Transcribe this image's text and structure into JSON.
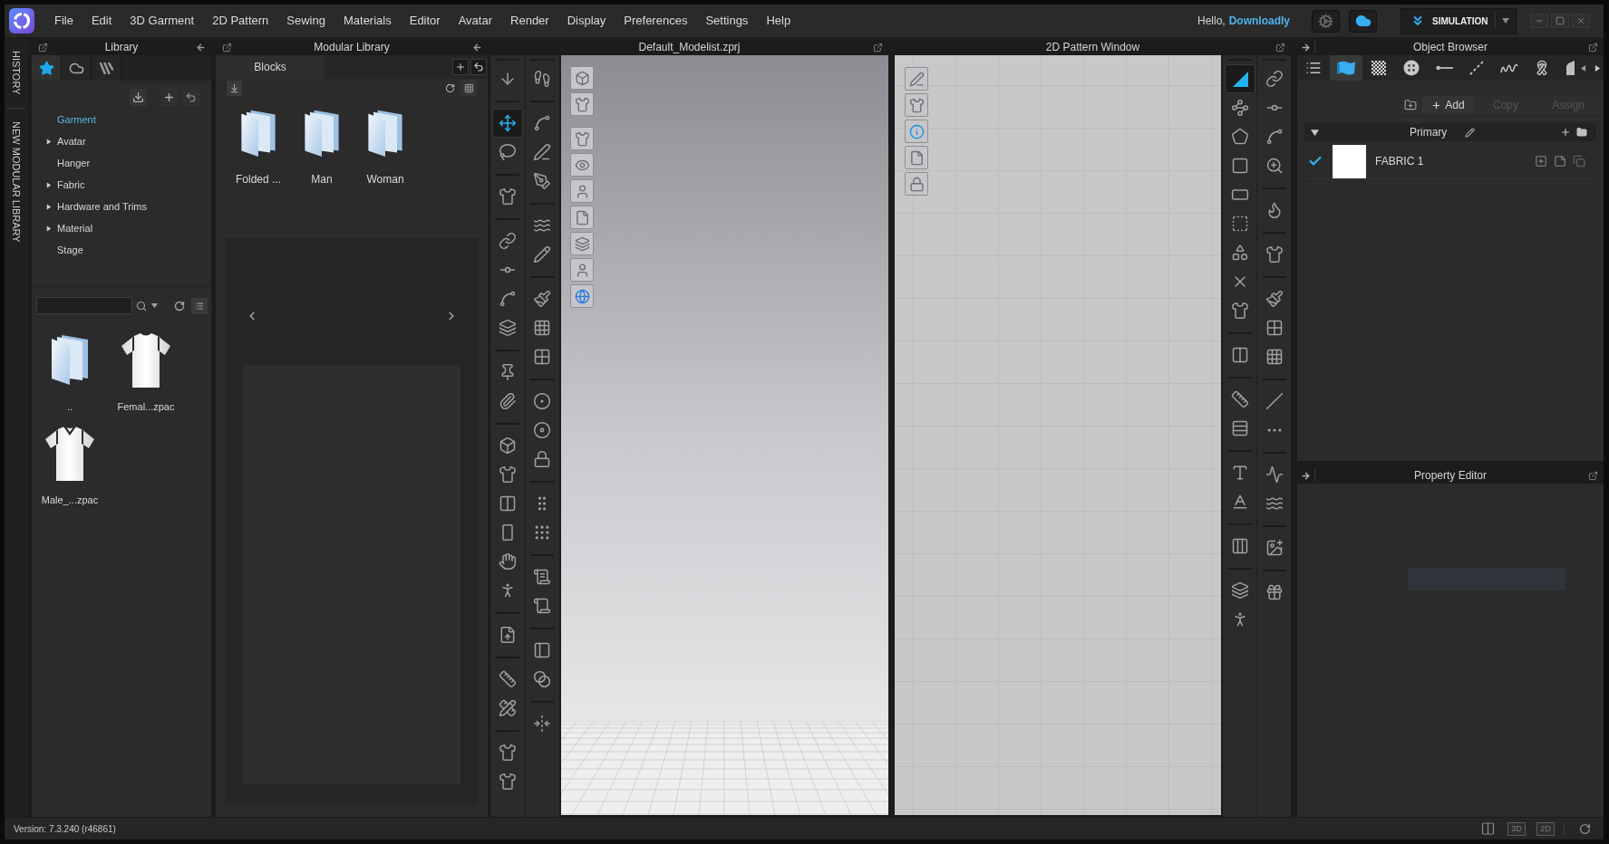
{
  "menu_bar": {
    "items": [
      "File",
      "Edit",
      "3D Garment",
      "2D Pattern",
      "Sewing",
      "Materials",
      "Editor",
      "Avatar",
      "Render",
      "Display",
      "Preferences",
      "Settings",
      "Help"
    ],
    "greeting": "Hello,",
    "user": "Downloadly",
    "mode": "SIMULATION"
  },
  "side_tabs": [
    {
      "label": "HISTORY"
    },
    {
      "label": "NEW MODULAR LIBRARY"
    }
  ],
  "library": {
    "title": "Library",
    "tabs": [
      {
        "selected": true
      },
      {
        "selected": false
      },
      {
        "selected": false
      }
    ],
    "tree": [
      {
        "label": "Garment",
        "selected": true,
        "expandable": false
      },
      {
        "label": "Avatar",
        "selected": false,
        "expandable": true
      },
      {
        "label": "Hanger",
        "selected": false,
        "expandable": false
      },
      {
        "label": "Fabric",
        "selected": false,
        "expandable": true
      },
      {
        "label": "Hardware and Trims",
        "selected": false,
        "expandable": true
      },
      {
        "label": "Material",
        "selected": false,
        "expandable": true
      },
      {
        "label": "Stage",
        "selected": false,
        "expandable": false
      }
    ],
    "files": [
      {
        "name": "..",
        "kind": "folder"
      },
      {
        "name": "Femal...zpac",
        "kind": "tshirt"
      },
      {
        "name": "Male_...zpac",
        "kind": "vneck"
      }
    ]
  },
  "modular_library": {
    "title": "Modular Library",
    "tabs": [
      {
        "label": "Blocks",
        "selected": true
      }
    ],
    "folders": [
      {
        "name": "Folded ..."
      },
      {
        "name": "Man"
      },
      {
        "name": "Woman"
      }
    ]
  },
  "window_3d": {
    "title": "Default_Modelist.zprj",
    "toolbar": [
      {
        "groups": [
          [
            {
              "selected": false
            }
          ],
          [
            {
              "selected": true
            },
            {
              "selected": false
            }
          ],
          [
            {
              "selected": false
            }
          ],
          [
            {
              "selected": false
            },
            {
              "selected": false
            },
            {
              "selected": false
            },
            {
              "selected": false
            }
          ],
          [
            {
              "selected": false
            },
            {
              "selected": false
            }
          ],
          [
            {
              "selected": false
            },
            {
              "selected": false
            },
            {
              "selected": false
            },
            {
              "selected": false
            },
            {
              "selected": false
            },
            {
              "selected": false
            }
          ],
          [
            {
              "selected": false
            }
          ],
          [
            {
              "selected": false
            },
            {
              "selected": false
            }
          ],
          [
            {
              "selected": false
            },
            {
              "selected": false
            }
          ]
        ]
      },
      {
        "groups": [
          [
            {
              "selected": false
            }
          ],
          [
            {
              "selected": false
            },
            {
              "selected": false
            },
            {
              "selected": false
            }
          ],
          [
            {
              "selected": false
            },
            {
              "selected": false
            }
          ],
          [
            {
              "selected": false
            },
            {
              "selected": false
            },
            {
              "selected": false
            }
          ],
          [
            {
              "selected": false
            },
            {
              "selected": false
            },
            {
              "selected": false
            }
          ],
          [
            {
              "selected": false
            },
            {
              "selected": false
            }
          ],
          [
            {
              "selected": false
            },
            {
              "selected": false
            }
          ],
          [
            {
              "selected": false
            },
            {
              "selected": false
            }
          ],
          [
            {
              "selected": false
            }
          ]
        ]
      }
    ]
  },
  "window_2d": {
    "title": "2D Pattern Window",
    "toolbar": [
      {
        "groups": [
          [
            {
              "selected": true
            },
            {
              "selected": false
            },
            {
              "selected": false
            },
            {
              "selected": false
            },
            {
              "selected": false
            },
            {
              "selected": false
            },
            {
              "selected": false
            },
            {
              "selected": false
            },
            {
              "selected": false
            }
          ],
          [
            {
              "selected": false
            }
          ],
          [
            {
              "selected": false
            },
            {
              "selected": false
            }
          ],
          [
            {
              "selected": false
            },
            {
              "selected": false
            }
          ],
          [
            {
              "selected": false
            }
          ],
          [
            {
              "selected": false
            },
            {
              "selected": false
            }
          ]
        ]
      },
      {
        "groups": [
          [
            {
              "selected": false
            },
            {
              "selected": false
            },
            {
              "selected": false
            },
            {
              "selected": false
            }
          ],
          [
            {
              "selected": false
            }
          ],
          [
            {
              "selected": false
            }
          ],
          [
            {
              "selected": false
            },
            {
              "selected": false
            },
            {
              "selected": false
            }
          ],
          [
            {
              "selected": false
            },
            {
              "selected": false
            }
          ],
          [
            {
              "selected": false
            },
            {
              "selected": false
            }
          ],
          [
            {
              "selected": false
            }
          ],
          [
            {
              "selected": false
            }
          ]
        ]
      }
    ]
  },
  "object_browser": {
    "title": "Object Browser",
    "tabs": [
      {
        "selected": false
      },
      {
        "selected": true
      },
      {
        "selected": false
      },
      {
        "selected": false
      },
      {
        "selected": false
      },
      {
        "selected": false
      },
      {
        "selected": false
      },
      {
        "selected": false
      },
      {
        "selected": false
      }
    ],
    "actions": [
      {
        "label": "Add",
        "disabled": false
      },
      {
        "label": "Copy",
        "disabled": true
      },
      {
        "label": "Assign",
        "disabled": true
      }
    ],
    "group": {
      "label": "Primary",
      "expanded": true
    },
    "items": [
      {
        "name": "FABRIC 1",
        "checked": true,
        "color": "#ffffff"
      }
    ]
  },
  "property_editor": {
    "title": "Property Editor"
  },
  "status_bar": {
    "version": "Version: 7.3.240 (r46861)",
    "views": [
      "3D",
      "2D"
    ]
  }
}
